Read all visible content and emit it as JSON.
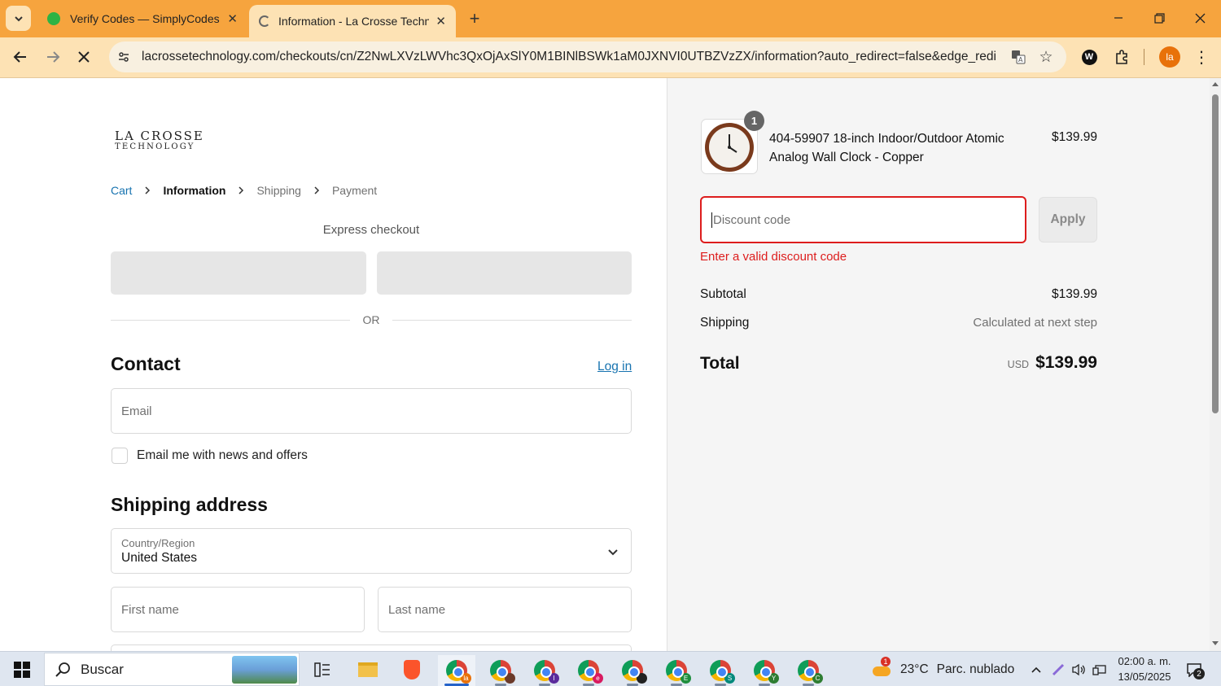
{
  "browser": {
    "tabs": [
      {
        "title": "Verify Codes — SimplyCodes"
      },
      {
        "title": "Information - La Crosse Technolog"
      }
    ],
    "url": "lacrossetechnology.com/checkouts/cn/Z2NwLXVzLWVhc3QxOjAxSlY0M1BINlBSWk1aM0JXNVI0UTBZVzZX/information?auto_redirect=false&edge_redirec...",
    "profile_initials": "la"
  },
  "store": {
    "logo_line1": "LA CROSSE",
    "logo_line2": "TECHNOLOGY",
    "breadcrumb": [
      "Cart",
      "Information",
      "Shipping",
      "Payment"
    ],
    "express_checkout": "Express checkout",
    "or": "OR",
    "contact_heading": "Contact",
    "login": "Log in",
    "email_placeholder": "Email",
    "news_checkbox_label": "Email me with news and offers",
    "shipping_heading": "Shipping address",
    "country_label": "Country/Region",
    "country_value": "United States",
    "first_name_placeholder": "First name",
    "last_name_placeholder": "Last name"
  },
  "summary": {
    "item_qty": "1",
    "item_name_line1": "404-59907 18-inch Indoor/Outdoor Atomic",
    "item_name_line2": "Analog Wall Clock - Copper",
    "item_price": "$139.99",
    "discount_placeholder": "Discount code",
    "apply": "Apply",
    "discount_error": "Enter a valid discount code",
    "subtotal_label": "Subtotal",
    "subtotal_value": "$139.99",
    "shipping_label": "Shipping",
    "shipping_value": "Calculated at next step",
    "total_label": "Total",
    "currency": "USD",
    "total_value": "$139.99"
  },
  "taskbar": {
    "search": "Buscar",
    "weather_temp": "23°C",
    "weather_text": "Parc. nublado",
    "time": "02:00 a. m.",
    "date": "13/05/2025",
    "notification_count": "2",
    "weather_badge": "1"
  },
  "colors": {
    "accent": "#1773b0",
    "error": "#dd1d1d",
    "tabbar": "#f6a43e"
  }
}
